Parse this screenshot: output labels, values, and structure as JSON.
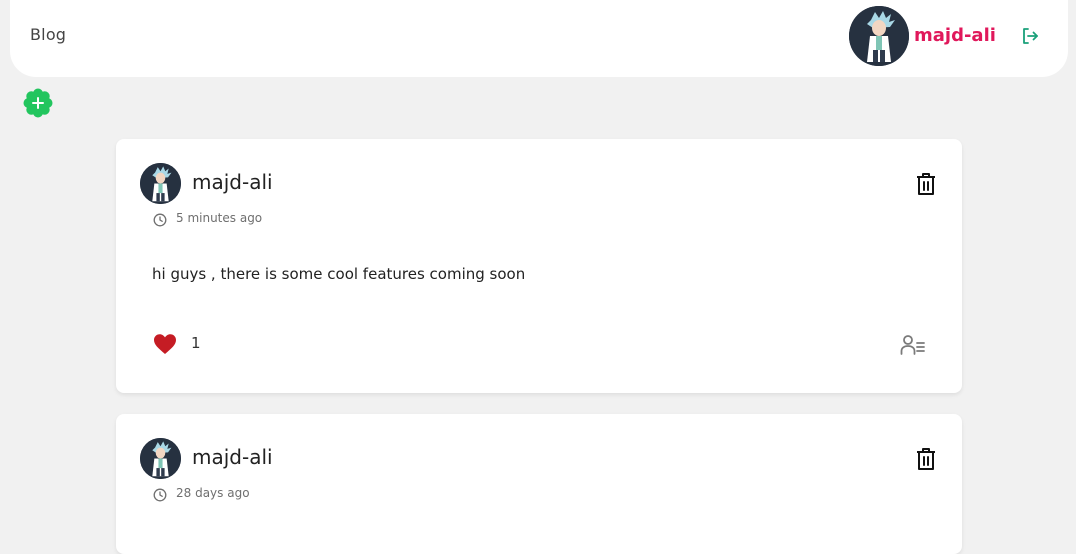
{
  "navbar": {
    "brand": "Blog",
    "username": "majd-ali"
  },
  "posts": [
    {
      "author": "majd-ali",
      "time": "5 minutes ago",
      "body": "hi guys , there is some cool features coming soon",
      "likes": "1"
    },
    {
      "author": "majd-ali",
      "time": "28 days ago"
    }
  ],
  "icons": {
    "logout": "logout-icon",
    "add": "plus-icon",
    "clock": "clock-icon",
    "delete": "trash-icon",
    "like": "heart-icon",
    "likers": "user-list-icon"
  },
  "colors": {
    "background": "#f1f1f1",
    "username": "#e0185b",
    "add_button": "#22c55e",
    "logout_icon": "#1aa07a",
    "heart": "#c51c24"
  }
}
